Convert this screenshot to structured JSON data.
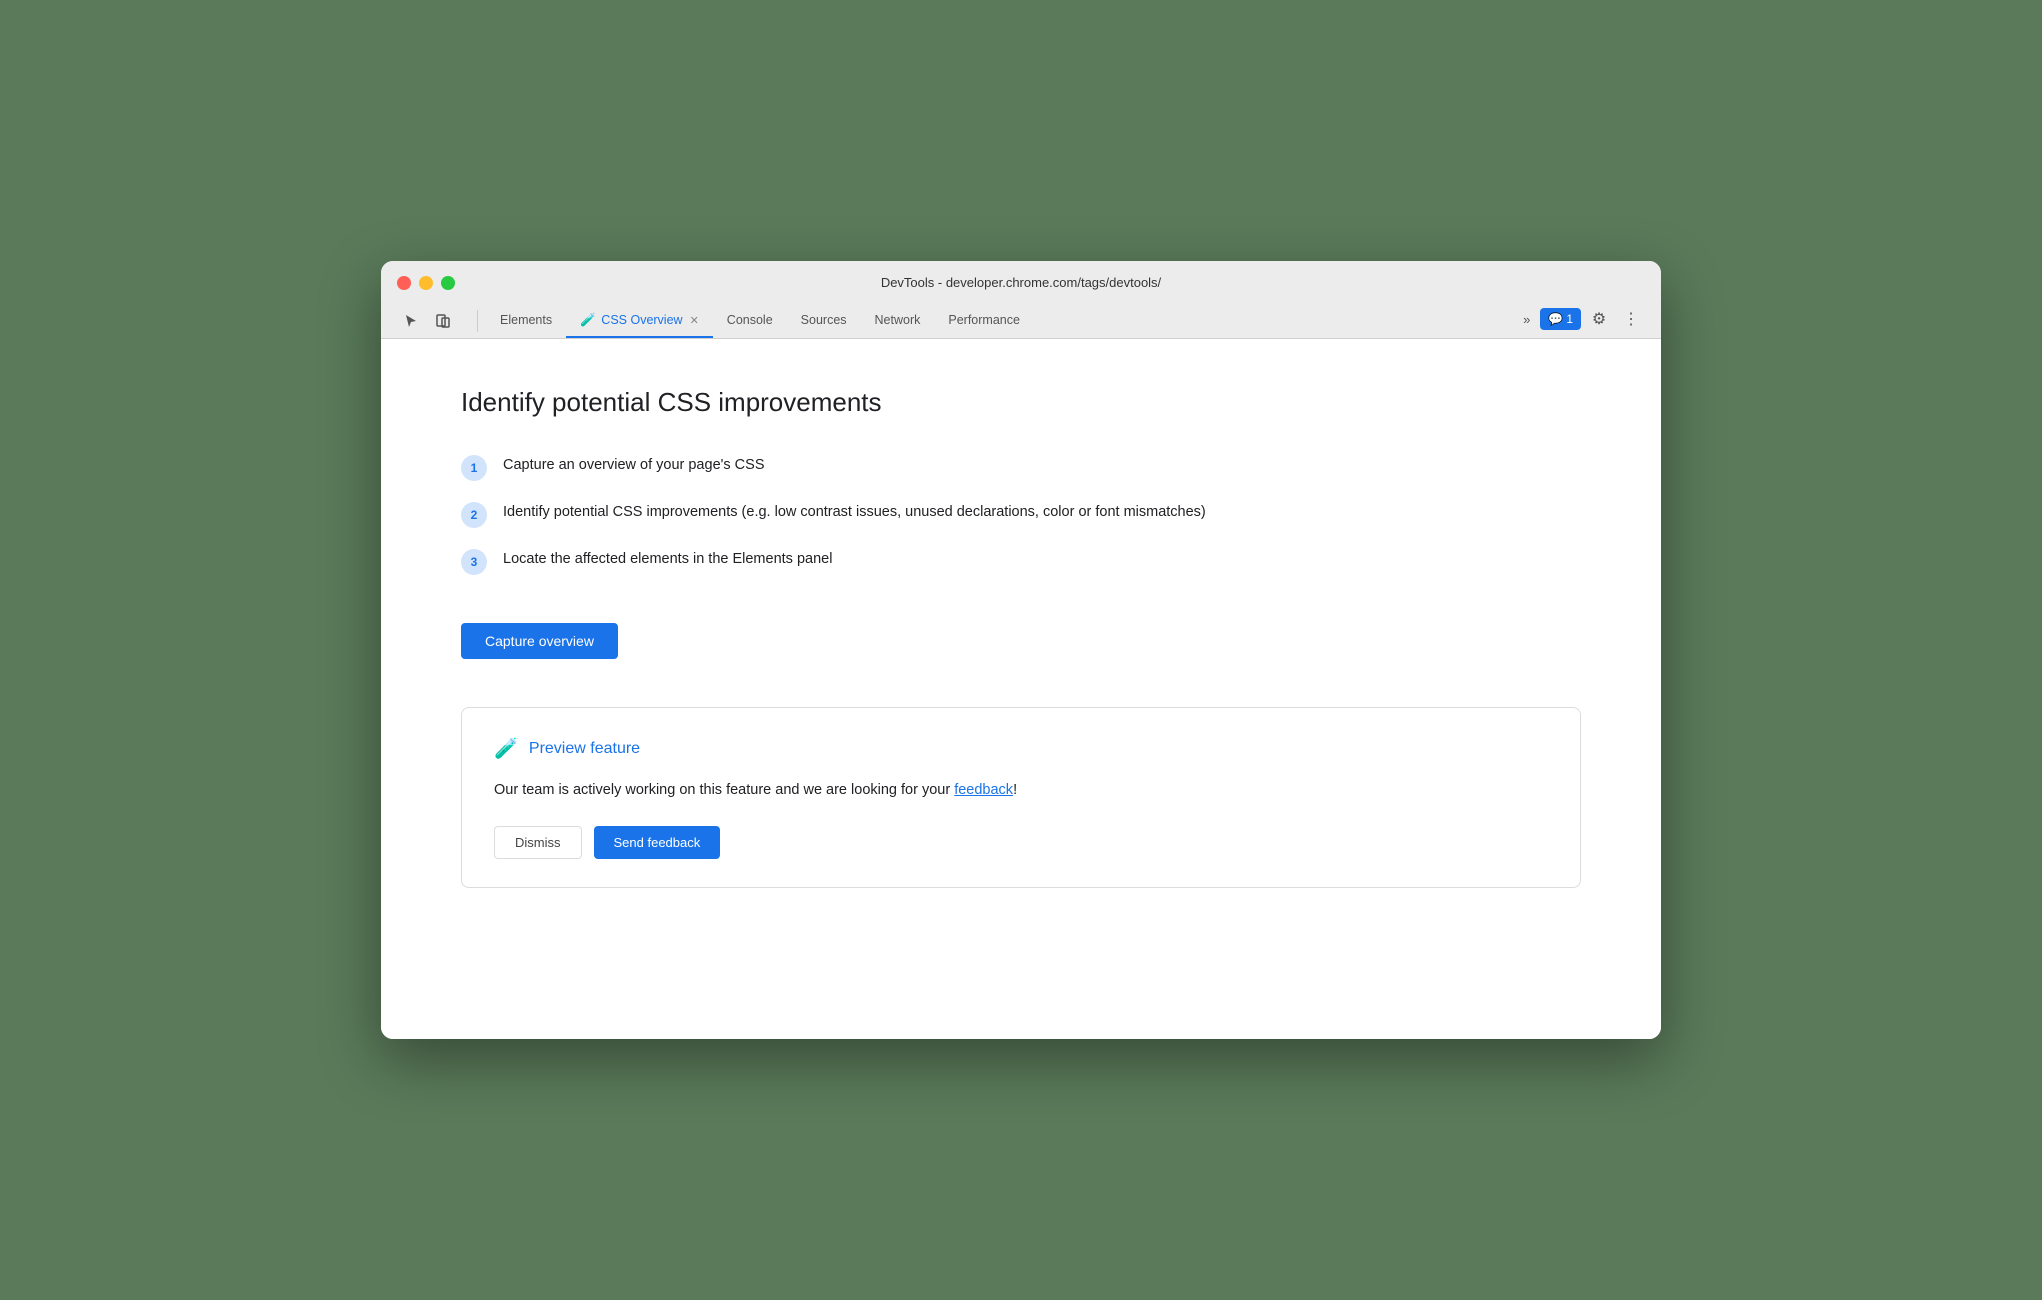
{
  "window": {
    "title": "DevTools - developer.chrome.com/tags/devtools/",
    "controls": {
      "close": "close",
      "minimize": "minimize",
      "maximize": "maximize"
    }
  },
  "tabs": {
    "items": [
      {
        "label": "Elements",
        "active": false,
        "closeable": false
      },
      {
        "label": "CSS Overview",
        "active": true,
        "closeable": true
      },
      {
        "label": "Console",
        "active": false,
        "closeable": false
      },
      {
        "label": "Sources",
        "active": false,
        "closeable": false
      },
      {
        "label": "Network",
        "active": false,
        "closeable": false
      },
      {
        "label": "Performance",
        "active": false,
        "closeable": false
      }
    ],
    "more_label": "»",
    "notification_count": "1",
    "settings_icon": "⚙",
    "dots_icon": "⋮"
  },
  "main": {
    "heading": "Identify potential CSS improvements",
    "steps": [
      {
        "number": "1",
        "text": "Capture an overview of your page's CSS"
      },
      {
        "number": "2",
        "text": "Identify potential CSS improvements (e.g. low contrast issues, unused declarations, color or font mismatches)"
      },
      {
        "number": "3",
        "text": "Locate the affected elements in the Elements panel"
      }
    ],
    "capture_button": "Capture overview",
    "preview_card": {
      "title": "Preview feature",
      "flask_icon": "🧪",
      "description_before": "Our team is actively working on this feature and we are looking for your ",
      "feedback_link": "feedback",
      "description_after": "!",
      "btn_dismiss": "Dismiss",
      "btn_send_feedback": "Send feedback"
    }
  }
}
